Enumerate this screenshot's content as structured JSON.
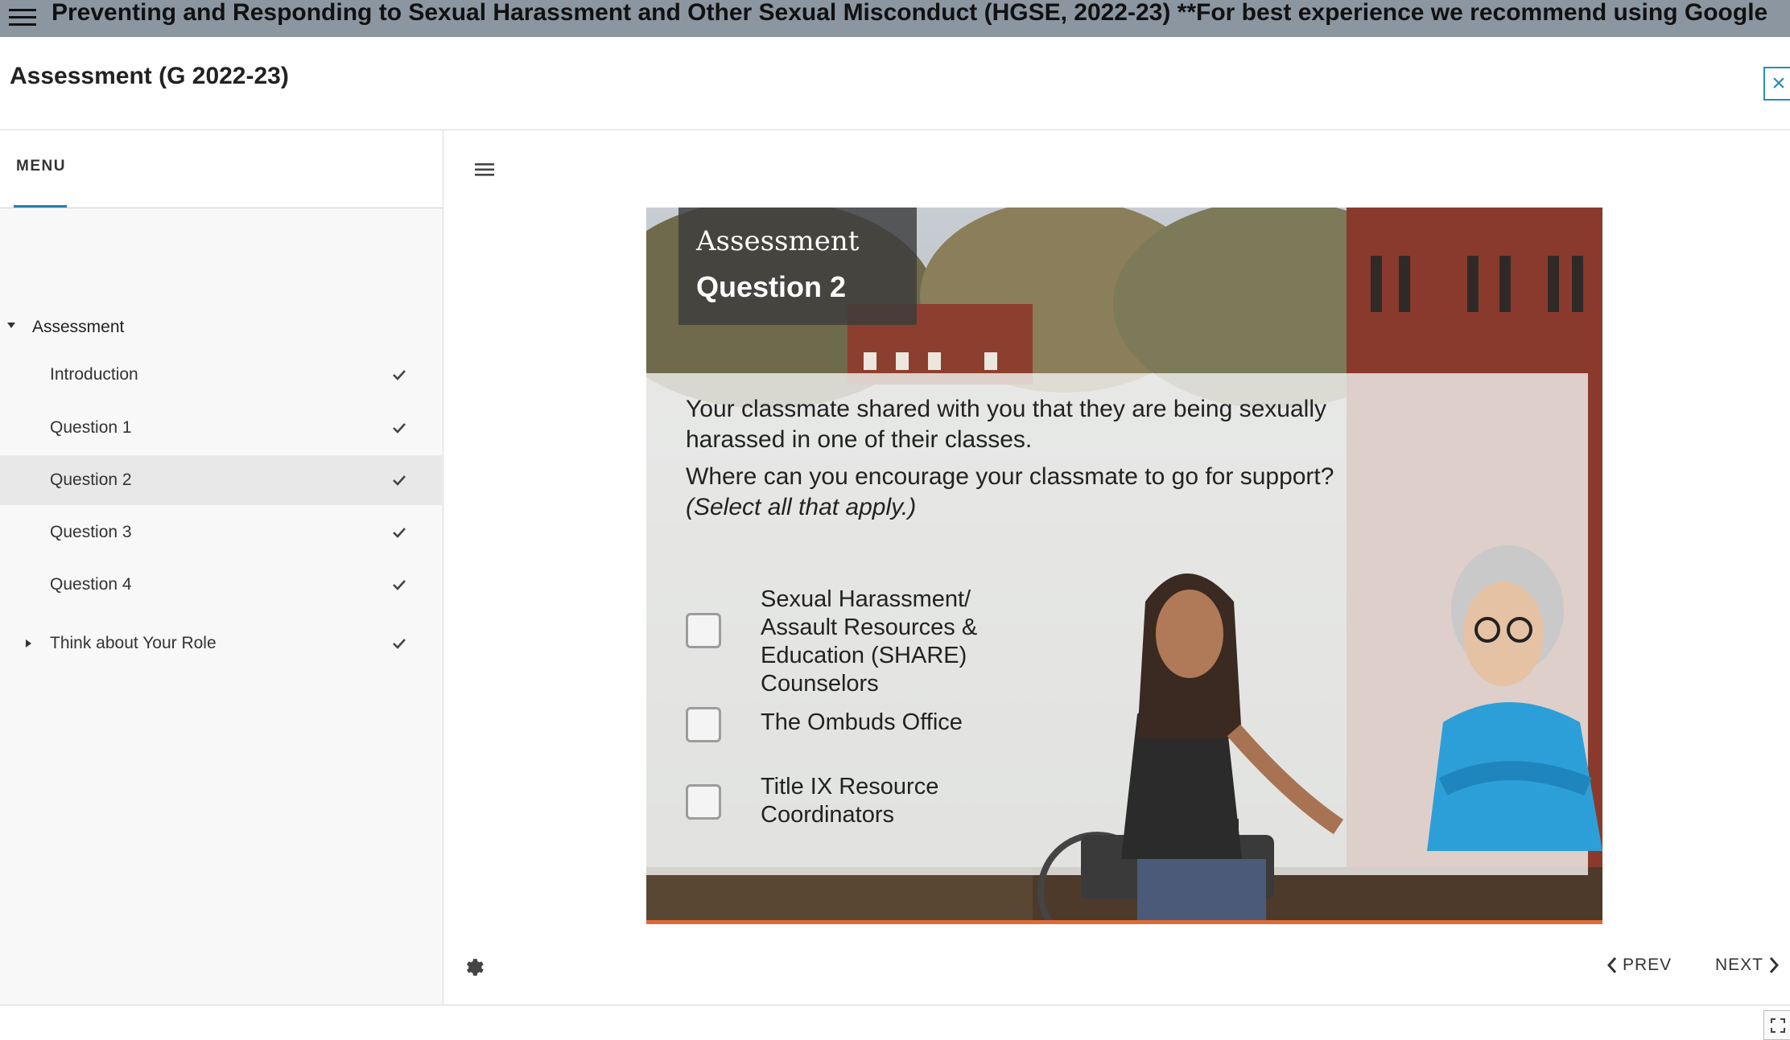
{
  "topbar": {
    "title": "Preventing and Responding to Sexual Harassment and Other Sexual Misconduct (HGSE, 2022-23) **For best experience we recommend using Google"
  },
  "header": {
    "course_title": "Assessment (G 2022-23)",
    "close_label": "×"
  },
  "sidebar": {
    "tab_label": "MENU",
    "root": {
      "label": "Assessment"
    },
    "items": [
      {
        "label": "Introduction",
        "complete": true
      },
      {
        "label": "Question 1",
        "complete": true
      },
      {
        "label": "Question 2",
        "complete": true,
        "active": true
      },
      {
        "label": "Question 3",
        "complete": true
      },
      {
        "label": "Question 4",
        "complete": true
      },
      {
        "label": "Think about Your Role",
        "complete": true,
        "collapsed": true
      }
    ]
  },
  "slide": {
    "title_line1": "Assessment",
    "title_line2": "Question 2",
    "question_p1": "Your classmate shared with you that they are being sexually harassed in one of their classes.",
    "question_p2_main": "Where can you encourage your classmate to go for support?",
    "question_p2_hint": "(Select all that apply.)",
    "options": [
      {
        "label": "Sexual Harassment/ Assault Resources & Education (SHARE) Counselors",
        "checked": false
      },
      {
        "label": "The Ombuds Office",
        "checked": false
      },
      {
        "label": "Title IX Resource Coordinators",
        "checked": false
      }
    ],
    "accent_color": "#e06a35"
  },
  "footer": {
    "prev_label": "PREV",
    "next_label": "NEXT"
  },
  "icons": {
    "menu": "hamburger-icon",
    "check": "checkmark-icon",
    "settings": "gear-icon",
    "fullscreen": "expand-icon"
  }
}
